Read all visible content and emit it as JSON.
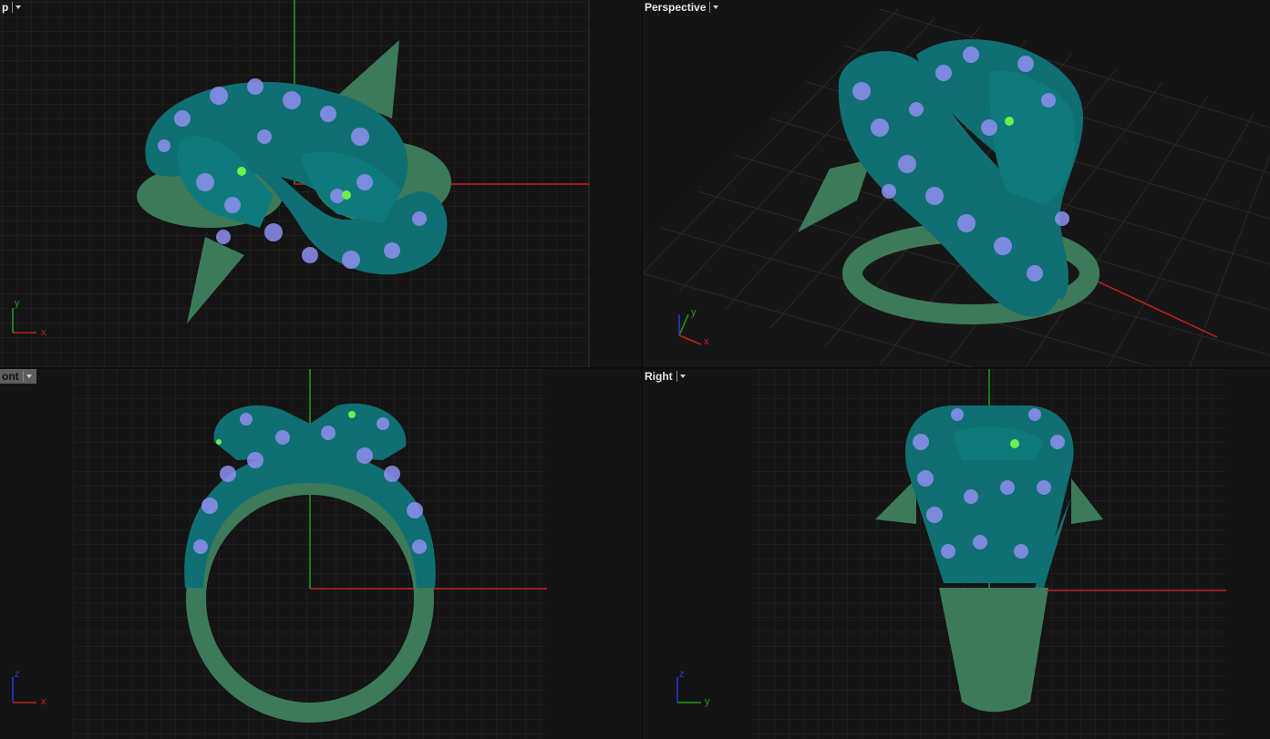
{
  "viewports": {
    "top": {
      "title": "p",
      "axes": [
        "y",
        "x"
      ]
    },
    "perspective": {
      "title": "Perspective",
      "axes": [
        "y",
        "x"
      ]
    },
    "front": {
      "title": "ont",
      "axes": [
        "z",
        "x"
      ]
    },
    "right": {
      "title": "Right",
      "axes": [
        "z",
        "y"
      ]
    }
  },
  "colors": {
    "background": "#141414",
    "grid_minor": "#2a2a2a",
    "grid_major": "#3a3a3a",
    "x_axis": "#c81e1e",
    "y_axis": "#1e9e1e",
    "z_axis": "#2a3ad8",
    "metal_teal": "#0f6f72",
    "metal_green": "#3c7a5c",
    "gem_lavender": "#8e8ff0",
    "eye_green": "#6cf04a"
  },
  "icons": {
    "dropdown": "chevron-down-icon",
    "axis_widget": "axis-triad-icon",
    "model": "snake-ring-model"
  }
}
